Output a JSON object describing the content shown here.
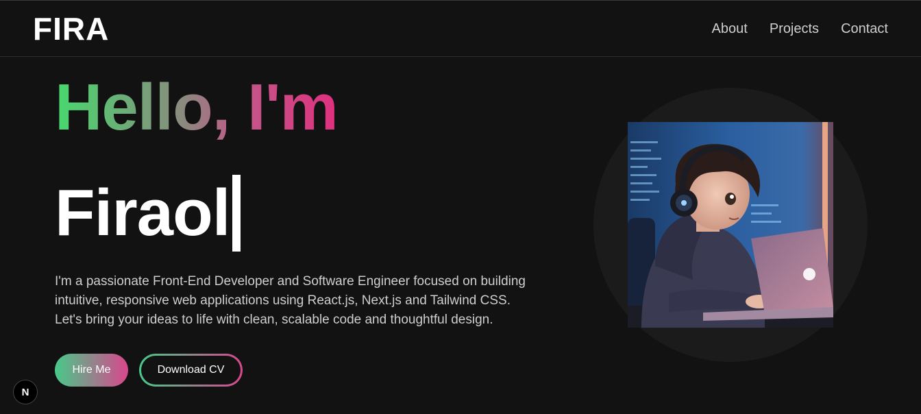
{
  "navbar": {
    "logo": "FIRA",
    "links": [
      "About",
      "Projects",
      "Contact"
    ]
  },
  "hero": {
    "greeting": "Hello, I'm",
    "name": "Firaol",
    "bio_lines": [
      "I'm a passionate Front-End Developer and Software Engineer focused on building",
      "intuitive, responsive web applications using React.js, Next.js and Tailwind CSS.",
      "Let's bring your ideas to life with clean, scalable code and thoughtful design."
    ],
    "hire_button": "Hire Me",
    "cv_button": "Download CV",
    "avatar_icon": "developer-avatar-illustration"
  },
  "badge": {
    "label": "N",
    "icon": "nextjs-logo-icon"
  },
  "colors": {
    "background": "#121212",
    "gradient_green": "#47d96e",
    "gradient_pink": "#e0307e",
    "text_muted": "#cfcfcf"
  }
}
